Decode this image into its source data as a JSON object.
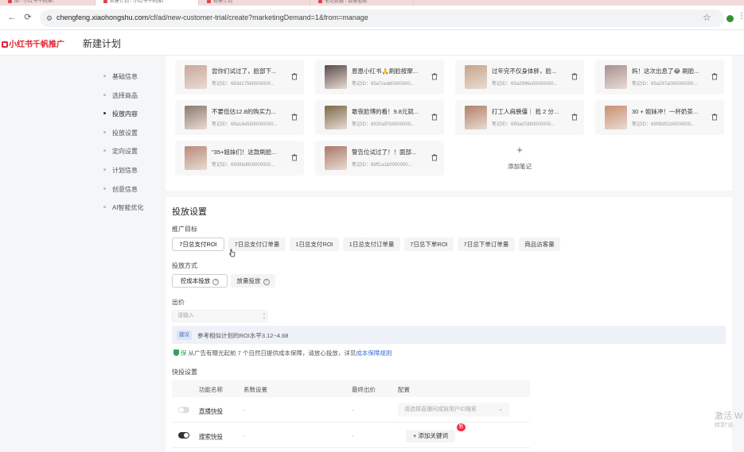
{
  "browser": {
    "tabs": [
      {
        "label": "图 - 小红书千帆推广",
        "active": false
      },
      {
        "label": "新建计划 - 小红书千帆推广",
        "active": true
      },
      {
        "label": "新建计划",
        "active": false
      },
      {
        "label": "笔记数据 - 数据看板",
        "active": false
      }
    ],
    "url_host": "chengfeng.xiaohongshu.com",
    "url_path": "/cf/ad/new-customer-trial/create?marketingDemand=1&from=manage"
  },
  "header": {
    "logo": "小红书千帆推广",
    "title": "新建计划"
  },
  "sidebar": {
    "items": [
      {
        "label": "基础信息",
        "active": false
      },
      {
        "label": "选择商品",
        "active": false
      },
      {
        "label": "投放内容",
        "active": true
      },
      {
        "label": "投放设置",
        "active": false
      },
      {
        "label": "定向设置",
        "active": false
      },
      {
        "label": "计划信息",
        "active": false
      },
      {
        "label": "创意信息",
        "active": false
      },
      {
        "label": "AI智能优化",
        "active": false
      }
    ]
  },
  "notes": {
    "id_prefix": "笔记ID：",
    "items": [
      {
        "title": "尝你们试过了，脸部下...",
        "id": "683d17560000000...",
        "thumb": "#c9a79a"
      },
      {
        "title": "恩恩小红书🙏刷脸按摩...",
        "id": "69a7cedd0000000...",
        "thumb": "#5a4a4a"
      },
      {
        "title": "过年完不仅身体胖，脸...",
        "id": "69a2996e00000000...",
        "thumb": "#c4a488"
      },
      {
        "title": "妈！这次出息了😂 刷脸...",
        "id": "69a287a000000000...",
        "thumb": "#a89090"
      },
      {
        "title": "不要低估12.8的购买力...",
        "id": "69a14e5800000000...",
        "thumb": "#8c7a6a"
      },
      {
        "title": "敢夜脸博的看！9.8元就...",
        "id": "6920a97b0000000...",
        "thumb": "#7a6a48"
      },
      {
        "title": "打工人肩膀僵｜ 抵 2 分...",
        "id": "690ad7d80000000...",
        "thumb": "#b08068"
      },
      {
        "title": "30 + 姐妹冲！一杯奶茶...",
        "id": "6909d51b0000000...",
        "thumb": "#c89070"
      },
      {
        "title": "\"35+姐妹们！这款刷脸...",
        "id": "69099d900000000...",
        "thumb": "#b88a78"
      },
      {
        "title": "警告位试过了！！面部...",
        "id": "68ff1a1b0000000...",
        "thumb": "#a87868"
      }
    ],
    "add_label": "添加笔记",
    "add_plus": "+"
  },
  "settings": {
    "title": "投放设置",
    "goal_label": "推广目标",
    "goals": [
      {
        "label": "7日总支付ROI",
        "selected": true
      },
      {
        "label": "7日总支付订单量",
        "selected": false
      },
      {
        "label": "1日总支付ROI",
        "selected": false
      },
      {
        "label": "1日总支付订单量",
        "selected": false
      },
      {
        "label": "7日总下单ROI",
        "selected": false
      },
      {
        "label": "7日总下单订单量",
        "selected": false
      },
      {
        "label": "商品访客量",
        "selected": false
      }
    ],
    "method_label": "投放方式",
    "methods": [
      {
        "label": "控成本投放",
        "selected": true
      },
      {
        "label": "放量投放",
        "selected": false
      }
    ],
    "bid_label": "出价",
    "bid_placeholder": "请输入",
    "tip_tag": "建议",
    "tip_text": "参考相似计划的ROI水平3.12~4.68",
    "guarantee_prefix": "从广告有曝光起前 7 个自然日提供成本保障，请放心投放，详见",
    "guarantee_link": "成本保障规则",
    "guarantee_badge": "保",
    "quick_label": "快投设置",
    "table": {
      "headers": [
        "功能名称",
        "系数设置",
        "最终出价",
        "配置"
      ],
      "rows": [
        {
          "name": "直播快投",
          "coef": "-",
          "final": "-",
          "config": "请选择直播间或按用户ID搜索",
          "enabled": false,
          "type": "select"
        },
        {
          "name": "搜索快投",
          "coef": "-",
          "final": "-",
          "config": "+ 添加关键词",
          "enabled": true,
          "type": "button",
          "badge": "新"
        }
      ]
    }
  },
  "watermark": {
    "line1": "激活 W",
    "line2": "转到“设"
  },
  "colors": {
    "brand": "#e0242f",
    "link": "#3b6fd6",
    "badge": "#ff2442",
    "success": "#2fa35a"
  }
}
